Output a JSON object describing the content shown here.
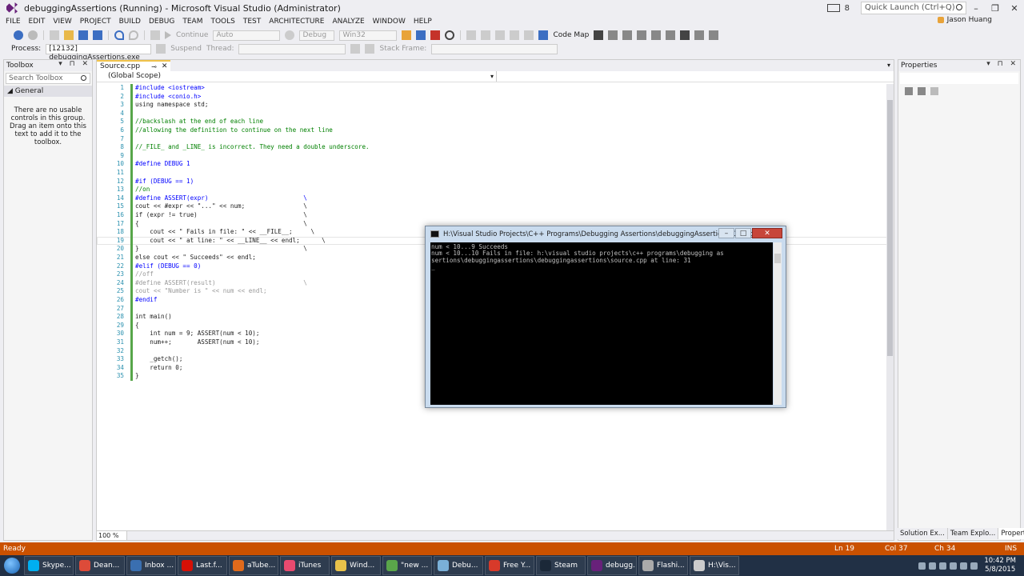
{
  "window": {
    "title": "debuggingAssertions (Running) - Microsoft Visual Studio (Administrator)",
    "quick_launch_placeholder": "Quick Launch (Ctrl+Q)",
    "notification_count": "8",
    "user": "Jason Huang"
  },
  "menu": [
    "FILE",
    "EDIT",
    "VIEW",
    "PROJECT",
    "BUILD",
    "DEBUG",
    "TEAM",
    "TOOLS",
    "TEST",
    "ARCHITECTURE",
    "ANALYZE",
    "WINDOW",
    "HELP"
  ],
  "toolbar": {
    "continue_label": "Continue",
    "config1": "Auto",
    "config2": "Debug",
    "platform": "Win32",
    "code_map": "Code Map",
    "process_label": "Process:",
    "process_value": "[12132] debuggingAssertions.exe",
    "suspend": "Suspend",
    "thread_label": "Thread:",
    "stack_frame_label": "Stack Frame:"
  },
  "toolbox": {
    "title": "Toolbox",
    "search_placeholder": "Search Toolbox",
    "group": "General",
    "empty_message": "There are no usable controls in this group. Drag an item onto this text to add it to the toolbox."
  },
  "editor": {
    "tab": "Source.cpp",
    "scope": "(Global Scope)",
    "zoom": "100 %",
    "lines": [
      {
        "n": "1",
        "text": "#include <iostream>",
        "type": "pp"
      },
      {
        "n": "2",
        "text": "#include <conio.h>",
        "type": "pp"
      },
      {
        "n": "3",
        "text": "using namespace std;",
        "type": "code"
      },
      {
        "n": "4",
        "text": "",
        "type": "code"
      },
      {
        "n": "5",
        "text": "//backslash at the end of each line",
        "type": "comment"
      },
      {
        "n": "6",
        "text": "//allowing the definition to continue on the next line",
        "type": "comment"
      },
      {
        "n": "7",
        "text": "",
        "type": "code"
      },
      {
        "n": "8",
        "text": "//_FILE_ and _LINE_ is incorrect. They need a double underscore.",
        "type": "comment"
      },
      {
        "n": "9",
        "text": "",
        "type": "code"
      },
      {
        "n": "10",
        "text": "#define DEBUG 1",
        "type": "pp"
      },
      {
        "n": "11",
        "text": "",
        "type": "code"
      },
      {
        "n": "12",
        "text": "#if (DEBUG == 1)",
        "type": "pp"
      },
      {
        "n": "13",
        "text": "//on",
        "type": "comment"
      },
      {
        "n": "14",
        "text": "#define ASSERT(expr)                          \\",
        "type": "pp"
      },
      {
        "n": "15",
        "text": "cout << #expr << \"...\" << num;                \\",
        "type": "code"
      },
      {
        "n": "16",
        "text": "if (expr != true)                             \\",
        "type": "code"
      },
      {
        "n": "17",
        "text": "{                                             \\",
        "type": "code"
      },
      {
        "n": "18",
        "text": "    cout << \" Fails in file: \" << __FILE__;     \\",
        "type": "code"
      },
      {
        "n": "19",
        "text": "    cout << \" at line: \" << __LINE__ << endl;      \\",
        "type": "code"
      },
      {
        "n": "20",
        "text": "}                                             \\",
        "type": "code"
      },
      {
        "n": "21",
        "text": "else cout << \" Succeeds\" << endl;",
        "type": "code"
      },
      {
        "n": "22",
        "text": "#elif (DEBUG == 0)",
        "type": "pp"
      },
      {
        "n": "23",
        "text": "//off",
        "type": "grey"
      },
      {
        "n": "24",
        "text": "#define ASSERT(result)                        \\",
        "type": "grey"
      },
      {
        "n": "25",
        "text": "cout << \"Number is \" << num << endl;",
        "type": "grey"
      },
      {
        "n": "26",
        "text": "#endif",
        "type": "pp"
      },
      {
        "n": "27",
        "text": "",
        "type": "code"
      },
      {
        "n": "28",
        "text": "int main()",
        "type": "code"
      },
      {
        "n": "29",
        "text": "{",
        "type": "code"
      },
      {
        "n": "30",
        "text": "    int num = 9; ASSERT(num < 10);",
        "type": "code"
      },
      {
        "n": "31",
        "text": "    num++;       ASSERT(num < 10);",
        "type": "code"
      },
      {
        "n": "32",
        "text": "",
        "type": "code"
      },
      {
        "n": "33",
        "text": "    _getch();",
        "type": "code"
      },
      {
        "n": "34",
        "text": "    return 0;",
        "type": "code"
      },
      {
        "n": "35",
        "text": "}",
        "type": "code"
      }
    ]
  },
  "properties": {
    "title": "Properties",
    "tabs": [
      "Solution Ex...",
      "Team Explo...",
      "Properties"
    ]
  },
  "console": {
    "title": "H:\\Visual Studio Projects\\C++ Programs\\Debugging Assertions\\debuggingAssertions\\Debug\\deb...",
    "output": "num < 10...9 Succeeds\nnum < 10...10 Fails in file: h:\\visual studio projects\\c++ programs\\debugging as\nsertions\\debuggingassertions\\debuggingassertions\\source.cpp at line: 31\n_"
  },
  "status": {
    "ready": "Ready",
    "ln": "Ln 19",
    "col": "Col 37",
    "ch": "Ch 34",
    "ins": "INS"
  },
  "taskbar": {
    "items": [
      {
        "label": "Skype...",
        "color": "#00aff0"
      },
      {
        "label": "Dean...",
        "color": "#dd4b39"
      },
      {
        "label": "Inbox ...",
        "color": "#3a6fb0"
      },
      {
        "label": "Last.f...",
        "color": "#d51007"
      },
      {
        "label": "aTube...",
        "color": "#e06a1b"
      },
      {
        "label": "iTunes",
        "color": "#e84a6f"
      },
      {
        "label": "Wind...",
        "color": "#e8c24a"
      },
      {
        "label": "\"new ...",
        "color": "#5aa64a"
      },
      {
        "label": "Debu...",
        "color": "#7ab0d8"
      },
      {
        "label": "Free Y...",
        "color": "#d83a2a"
      },
      {
        "label": "Steam",
        "color": "#1b2838"
      },
      {
        "label": "debugg...",
        "color": "#68217a"
      },
      {
        "label": "Flashi...",
        "color": "#aaaaaa"
      },
      {
        "label": "H:\\Vis...",
        "color": "#cccccc"
      }
    ],
    "time": "10:42 PM",
    "date": "5/8/2015"
  },
  "colors": {
    "statusbar": "#ca5100",
    "taskbar": "#213045",
    "accent_tab": "#f0c24a"
  }
}
